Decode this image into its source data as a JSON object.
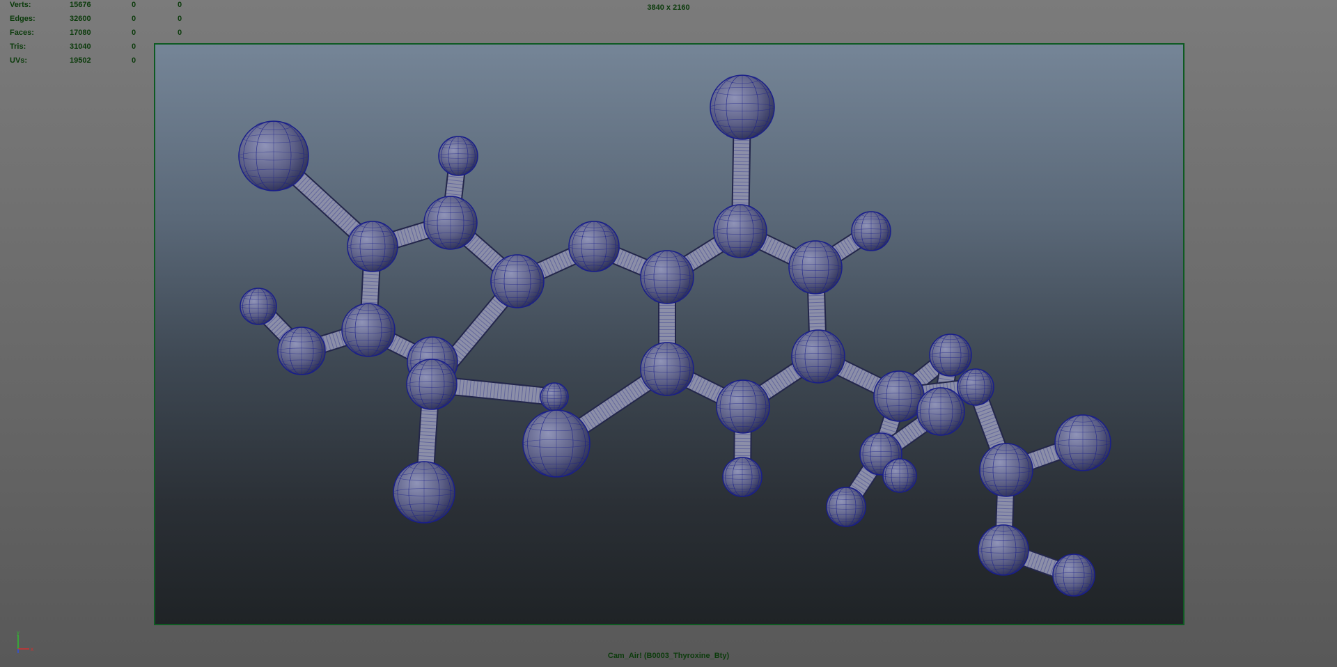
{
  "hud": {
    "stats": [
      {
        "label": "Verts:",
        "v1": "15676",
        "v2": "0",
        "v3": "0"
      },
      {
        "label": "Edges:",
        "v1": "32600",
        "v2": "0",
        "v3": "0"
      },
      {
        "label": "Faces:",
        "v1": "17080",
        "v2": "0",
        "v3": "0"
      },
      {
        "label": "Tris:",
        "v1": "31040",
        "v2": "0",
        "v3": "0"
      },
      {
        "label": "UVs:",
        "v1": "19502",
        "v2": "0",
        "v3": "0"
      }
    ],
    "resolution": "3840 x 2160",
    "camera": "Cam_Air! (B0003_Thyroxine_Bty)"
  },
  "axis": {
    "y_label": "y",
    "x_label": "x"
  },
  "colors": {
    "hud_text": "#0b3b0b",
    "gate": "#0e5a22",
    "atom_fill": "#5c5f86",
    "wire": "#1a1f8a"
  }
}
